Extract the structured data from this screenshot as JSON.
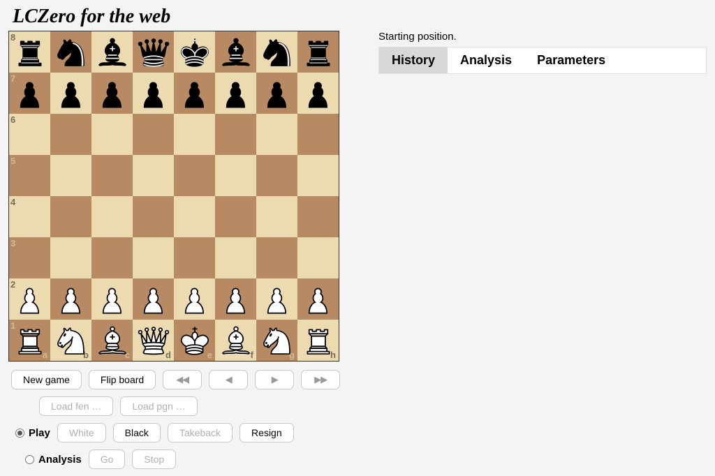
{
  "title": "LCZero for the web",
  "status": "Starting position.",
  "tabs": {
    "history": "History",
    "analysis": "Analysis",
    "parameters": "Parameters",
    "active": "history"
  },
  "buttons": {
    "newgame": "New game",
    "flip": "Flip board",
    "first": "◀◀",
    "prev": "◀",
    "next": "▶",
    "last": "▶▶",
    "loadfen": "Load fen …",
    "loadpgn": "Load pgn …",
    "white": "White",
    "black": "Black",
    "takeback": "Takeback",
    "resign": "Resign",
    "go": "Go",
    "stop": "Stop"
  },
  "modes": {
    "play": "Play",
    "analysis": "Analysis",
    "selected": "play"
  },
  "ranks": [
    "8",
    "7",
    "6",
    "5",
    "4",
    "3",
    "2",
    "1"
  ],
  "files": [
    "a",
    "b",
    "c",
    "d",
    "e",
    "f",
    "g",
    "h"
  ],
  "board_fen": "rnbqkbnr/pppppppp/8/8/8/8/PPPPPPPP/RNBQKBNR",
  "colors": {
    "light": "#ecdab0",
    "dark": "#b88a63"
  },
  "position": [
    [
      "r",
      "n",
      "b",
      "q",
      "k",
      "b",
      "n",
      "r"
    ],
    [
      "p",
      "p",
      "p",
      "p",
      "p",
      "p",
      "p",
      "p"
    ],
    [
      "",
      "",
      "",
      "",
      "",
      "",
      "",
      ""
    ],
    [
      "",
      "",
      "",
      "",
      "",
      "",
      "",
      ""
    ],
    [
      "",
      "",
      "",
      "",
      "",
      "",
      "",
      ""
    ],
    [
      "",
      "",
      "",
      "",
      "",
      "",
      "",
      ""
    ],
    [
      "P",
      "P",
      "P",
      "P",
      "P",
      "P",
      "P",
      "P"
    ],
    [
      "R",
      "N",
      "B",
      "Q",
      "K",
      "B",
      "N",
      "R"
    ]
  ]
}
